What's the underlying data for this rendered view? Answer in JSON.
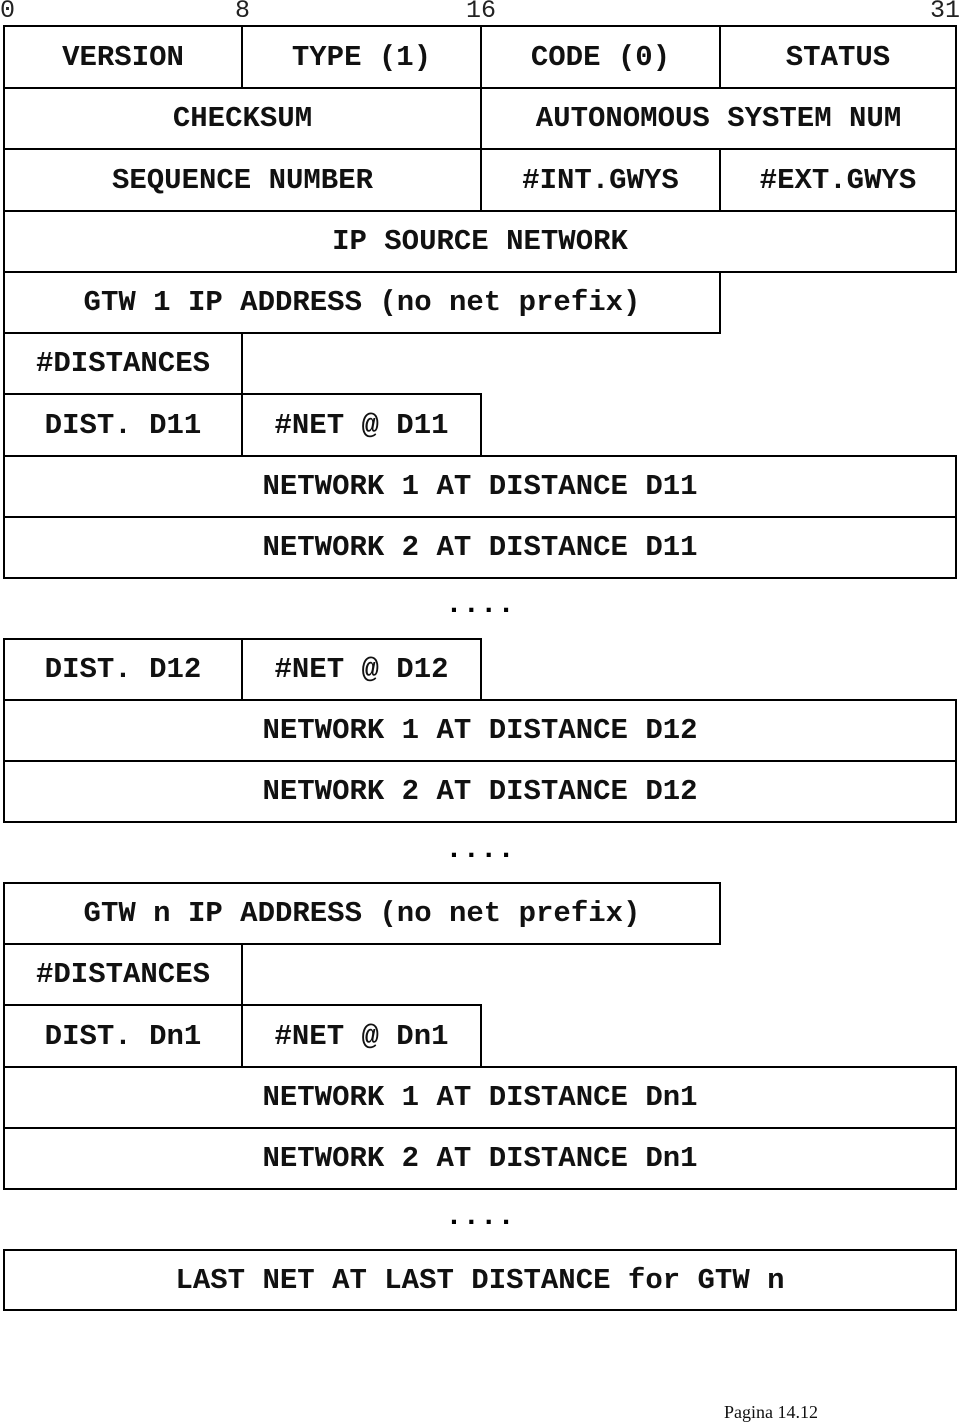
{
  "bit_ruler": [
    "0",
    "8",
    "16",
    "31"
  ],
  "header": {
    "version": "VERSION",
    "type": "TYPE (1)",
    "code": "CODE (0)",
    "status": "STATUS",
    "checksum": "CHECKSUM",
    "as_num": "AUTONOMOUS SYSTEM NUM",
    "seq": "SEQUENCE NUMBER",
    "int_gwys": "#INT.GWYS",
    "ext_gwys": "#EXT.GWYS",
    "ip_source": "IP SOURCE NETWORK"
  },
  "gateway1": {
    "address": "GTW 1 IP ADDRESS (no net prefix)",
    "distances": "#DISTANCES",
    "d11": {
      "dist": "DIST. D11",
      "count": "#NET @ D11",
      "net1": "NETWORK 1 AT DISTANCE D11",
      "net2": "NETWORK 2 AT DISTANCE D11",
      "ellipsis": "...."
    },
    "d12": {
      "dist": "DIST. D12",
      "count": "#NET @ D12",
      "net1": "NETWORK 1 AT DISTANCE D12",
      "net2": "NETWORK 2 AT DISTANCE D12",
      "ellipsis": "...."
    }
  },
  "gatewayn": {
    "address": "GTW n IP ADDRESS (no net prefix)",
    "distances": "#DISTANCES",
    "dn1": {
      "dist": "DIST. Dn1",
      "count": "#NET @ Dn1",
      "net1": "NETWORK 1 AT DISTANCE Dn1",
      "net2": "NETWORK 2 AT DISTANCE Dn1",
      "ellipsis": "...."
    },
    "last": "LAST NET AT LAST DISTANCE for GTW n"
  },
  "footer": "Pagina 14.12"
}
